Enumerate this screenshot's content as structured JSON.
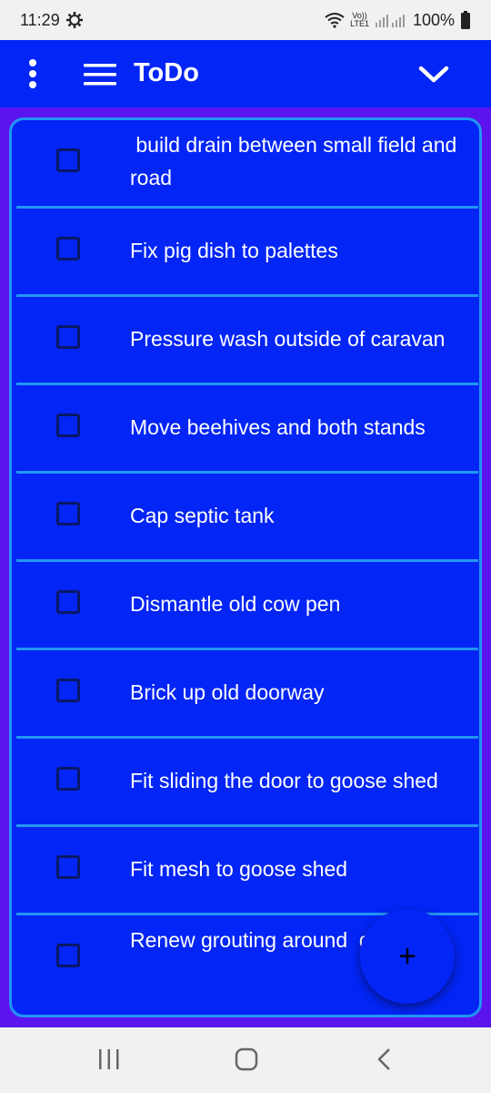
{
  "status": {
    "time": "11:29",
    "network_top": "Vo))",
    "network_bottom": "LTE1",
    "battery": "100%"
  },
  "app_bar": {
    "title": "ToDo"
  },
  "todos": [
    {
      "text": " build drain between small field and road",
      "checked": false
    },
    {
      "text": "Fix pig dish to palettes",
      "checked": false
    },
    {
      "text": "Pressure wash outside of caravan",
      "checked": false
    },
    {
      "text": "Move beehives and both stands",
      "checked": false
    },
    {
      "text": "Cap septic tank",
      "checked": false
    },
    {
      "text": "Dismantle old cow pen",
      "checked": false
    },
    {
      "text": "Brick up old doorway",
      "checked": false
    },
    {
      "text": "Fit sliding the door to goose shed",
      "checked": false
    },
    {
      "text": "Fit mesh to goose shed",
      "checked": false
    },
    {
      "text": "Renew grouting around  ge in van",
      "checked": false
    }
  ],
  "fab": {
    "label": "+"
  },
  "colors": {
    "primary": "#0325f5",
    "accent": "#2196f3",
    "background": "#5b14ee"
  },
  "icons": [
    "gear-icon",
    "wifi-icon",
    "signal-icon",
    "battery-icon",
    "kebab-menu-icon",
    "hamburger-icon",
    "chevron-down-icon",
    "plus-icon",
    "recents-icon",
    "home-icon",
    "back-icon"
  ]
}
